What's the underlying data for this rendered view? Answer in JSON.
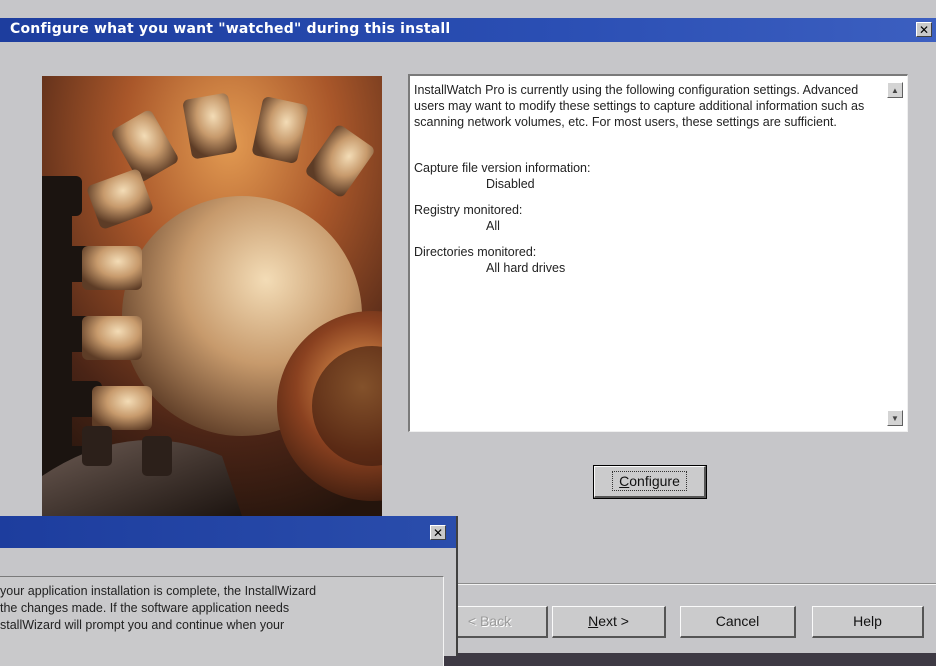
{
  "window": {
    "title": "Configure what you want \"watched\" during this install",
    "close_glyph": "✕"
  },
  "info": {
    "intro": "InstallWatch Pro is currently using the following configuration settings. Advanced users may want to modify these settings to capture additional information such as scanning network volumes, etc. For most users, these settings are sufficient.",
    "settings": [
      {
        "label": "Capture file version information:",
        "value": "Disabled"
      },
      {
        "label": "Registry monitored:",
        "value": "All"
      },
      {
        "label": "Directories monitored:",
        "value": "All hard drives"
      }
    ]
  },
  "buttons": {
    "configure": {
      "key": "C",
      "rest": "onfigure"
    },
    "back": "< Back",
    "next": {
      "key": "N",
      "rest": "ext >"
    },
    "cancel": "Cancel",
    "help": "Help"
  },
  "second_window": {
    "close_glyph": "✕",
    "text_lines": [
      "your application installation is complete, the InstallWizard",
      " the changes made.  If the software application needs",
      "stallWizard will prompt you and continue when your"
    ]
  },
  "icons": {
    "close": "close-icon",
    "scroll_up": "scroll-up-arrow-icon",
    "scroll_down": "scroll-down-arrow-icon"
  }
}
